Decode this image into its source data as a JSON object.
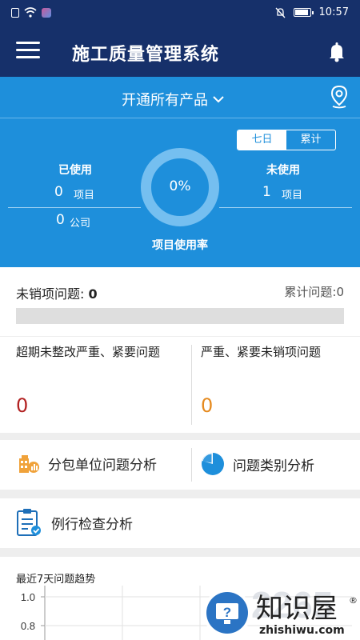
{
  "status_bar": {
    "time": "10:57"
  },
  "header": {
    "title": "施工质量管理系统",
    "menu_icon": "menu-icon",
    "bell_icon": "bell-icon"
  },
  "product": {
    "selected": "开通所有产品",
    "location_icon": "location-pin-icon"
  },
  "range_toggle": {
    "seven_days": "七日",
    "cumulative": "累计",
    "active": "七日"
  },
  "usage": {
    "used_label": "已使用",
    "used_projects_value": "0",
    "used_projects_unit": "项目",
    "used_companies_value": "0",
    "used_companies_unit": "公司",
    "unused_label": "未使用",
    "unused_projects_value": "1",
    "unused_projects_unit": "项目",
    "rate_value": "0%",
    "rate_fraction": 0,
    "rate_label": "项目使用率"
  },
  "unresolved": {
    "label": "未销项问题:",
    "value": "0",
    "cumulative": "累计问题:0",
    "progress_fraction": 0
  },
  "issues": {
    "overdue_label": "超期未整改严重、紧要问题",
    "overdue_value": "0",
    "overdue_color": "#b22222",
    "serious_label": "严重、紧要未销项问题",
    "serious_value": "0",
    "serious_color": "#e58a1f"
  },
  "analysis": {
    "subcontractor": "分包单位问题分析",
    "category": "问题类别分析"
  },
  "routine": {
    "label": "例行检查分析"
  },
  "trend": {
    "title": "最近7天问题趋势"
  },
  "chart_data": {
    "type": "line",
    "ylim": [
      0.8,
      1.0
    ],
    "yticks": [
      "1.0",
      "0.8"
    ],
    "series": []
  },
  "watermark": {
    "text": "知识屋",
    "sub": "zhishiwu.com",
    "mark": "®",
    "digits": "2265",
    "icon": "help-monitor-icon"
  },
  "colors": {
    "navy": "#16306a",
    "accent": "#1e8fdb"
  }
}
